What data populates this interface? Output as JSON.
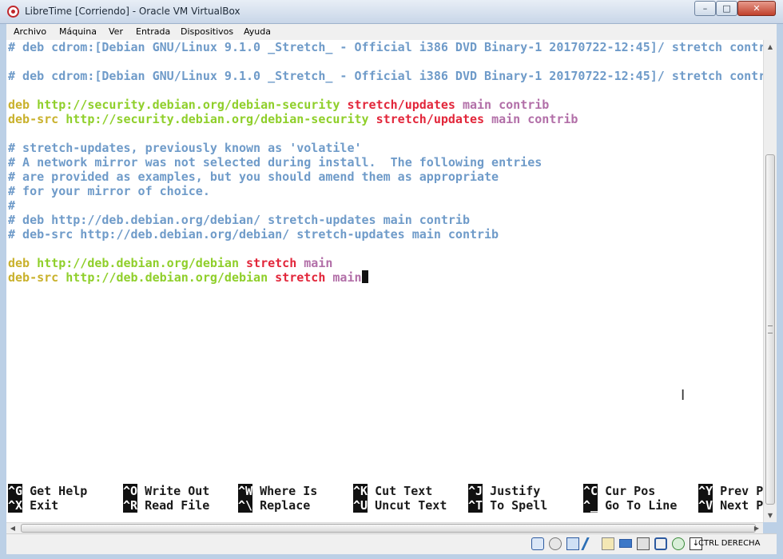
{
  "window": {
    "title": "LibreTime [Corriendo] - Oracle VM VirtualBox",
    "min_label": "–",
    "max_label": "□",
    "close_label": "✕"
  },
  "menu": [
    "Archivo",
    "Máquina",
    "Ver",
    "Entrada",
    "Dispositivos",
    "Ayuda"
  ],
  "editor": {
    "lines": [
      [
        {
          "t": "# deb cdrom:[Debian GNU/Linux 9.1.0 _Stretch_ - Official i386 DVD Binary-1 20170722-12:45]/ stretch contr",
          "c": "comment"
        }
      ],
      [],
      [
        {
          "t": "# deb cdrom:[Debian GNU/Linux 9.1.0 _Stretch_ - Official i386 DVD Binary-1 20170722-12:45]/ stretch contr",
          "c": "comment"
        }
      ],
      [],
      [
        {
          "t": "deb ",
          "c": "kw"
        },
        {
          "t": "http://security.debian.org/debian-security ",
          "c": "url"
        },
        {
          "t": "stretch/updates ",
          "c": "dist"
        },
        {
          "t": "main contrib",
          "c": "comp"
        }
      ],
      [
        {
          "t": "deb-src ",
          "c": "kw"
        },
        {
          "t": "http://security.debian.org/debian-security ",
          "c": "url"
        },
        {
          "t": "stretch/updates ",
          "c": "dist"
        },
        {
          "t": "main contrib",
          "c": "comp"
        }
      ],
      [],
      [
        {
          "t": "# stretch-updates, previously known as 'volatile'",
          "c": "comment"
        }
      ],
      [
        {
          "t": "# A network mirror was not selected during install.  The following entries",
          "c": "comment"
        }
      ],
      [
        {
          "t": "# are provided as examples, but you should amend them as appropriate",
          "c": "comment"
        }
      ],
      [
        {
          "t": "# for your mirror of choice.",
          "c": "comment"
        }
      ],
      [
        {
          "t": "#",
          "c": "comment"
        }
      ],
      [
        {
          "t": "# deb http://deb.debian.org/debian/ stretch-updates main contrib",
          "c": "comment"
        }
      ],
      [
        {
          "t": "# deb-src http://deb.debian.org/debian/ stretch-updates main contrib",
          "c": "comment"
        }
      ],
      [],
      [
        {
          "t": "deb ",
          "c": "kw"
        },
        {
          "t": "http://deb.debian.org/debian ",
          "c": "url"
        },
        {
          "t": "stretch ",
          "c": "dist"
        },
        {
          "t": "main",
          "c": "comp"
        }
      ],
      [
        {
          "t": "deb-src ",
          "c": "kw"
        },
        {
          "t": "http://deb.debian.org/debian ",
          "c": "url"
        },
        {
          "t": "stretch ",
          "c": "dist"
        },
        {
          "t": "main",
          "c": "comp"
        },
        {
          "t": "",
          "c": "cursor"
        }
      ]
    ]
  },
  "shortcuts": {
    "row1": [
      {
        "key": "^G",
        "label": "Get Help"
      },
      {
        "key": "^O",
        "label": "Write Out"
      },
      {
        "key": "^W",
        "label": "Where Is"
      },
      {
        "key": "^K",
        "label": "Cut Text"
      },
      {
        "key": "^J",
        "label": "Justify"
      },
      {
        "key": "^C",
        "label": "Cur Pos"
      },
      {
        "key": "^Y",
        "label": "Prev P"
      }
    ],
    "row2": [
      {
        "key": "^X",
        "label": "Exit"
      },
      {
        "key": "^R",
        "label": "Read File"
      },
      {
        "key": "^\\",
        "label": "Replace"
      },
      {
        "key": "^U",
        "label": "Uncut Text"
      },
      {
        "key": "^T",
        "label": "To Spell"
      },
      {
        "key": "^_",
        "label": "Go To Line"
      },
      {
        "key": "^V",
        "label": "Next P"
      }
    ]
  },
  "statusbar": {
    "icons": [
      "hdd-icon",
      "optical-disc-icon",
      "network-icon",
      "usb-icon",
      "shared-folder-icon",
      "display-icon",
      "recording-icon",
      "cpu-icon",
      "mouse-integration-icon",
      "arrow-down-icon"
    ],
    "host_key": "CTRL DERECHA"
  }
}
